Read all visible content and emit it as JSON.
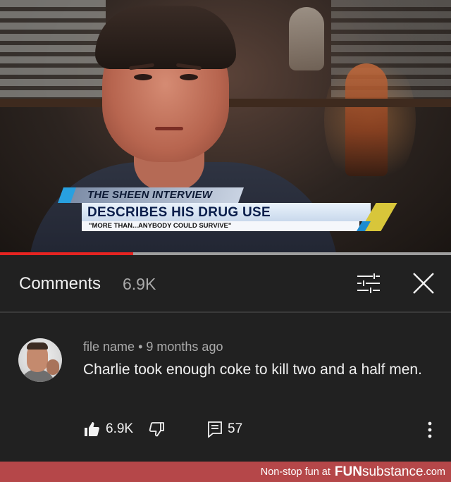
{
  "video": {
    "lower_third": {
      "kicker": "THE SHEEN INTERVIEW",
      "headline": "DESCRIBES HIS DRUG USE",
      "quote": "\"MORE THAN...ANYBODY COULD SURVIVE\""
    },
    "progress_fraction": 0.295
  },
  "comments_panel": {
    "title": "Comments",
    "count": "6.9K",
    "icons": {
      "sort": "sort-filter-icon",
      "close": "close-icon"
    }
  },
  "comment": {
    "author": "file name",
    "separator": "•",
    "time": "9 months ago",
    "text": "Charlie took enough coke to kill two and a half men.",
    "likes": "6.9K",
    "replies": "57",
    "icons": {
      "like": "thumbs-up-icon",
      "dislike": "thumbs-down-icon",
      "reply": "reply-icon",
      "more": "more-vertical-icon"
    }
  },
  "footer": {
    "prefix": "Non-stop fun at",
    "brand_bold": "FUN",
    "brand_rest": "substance",
    "brand_suffix": ".com",
    "color": "#b54749"
  },
  "colors": {
    "progress": "#e52421",
    "background": "#212121",
    "muted_text": "#aaaaaa"
  }
}
